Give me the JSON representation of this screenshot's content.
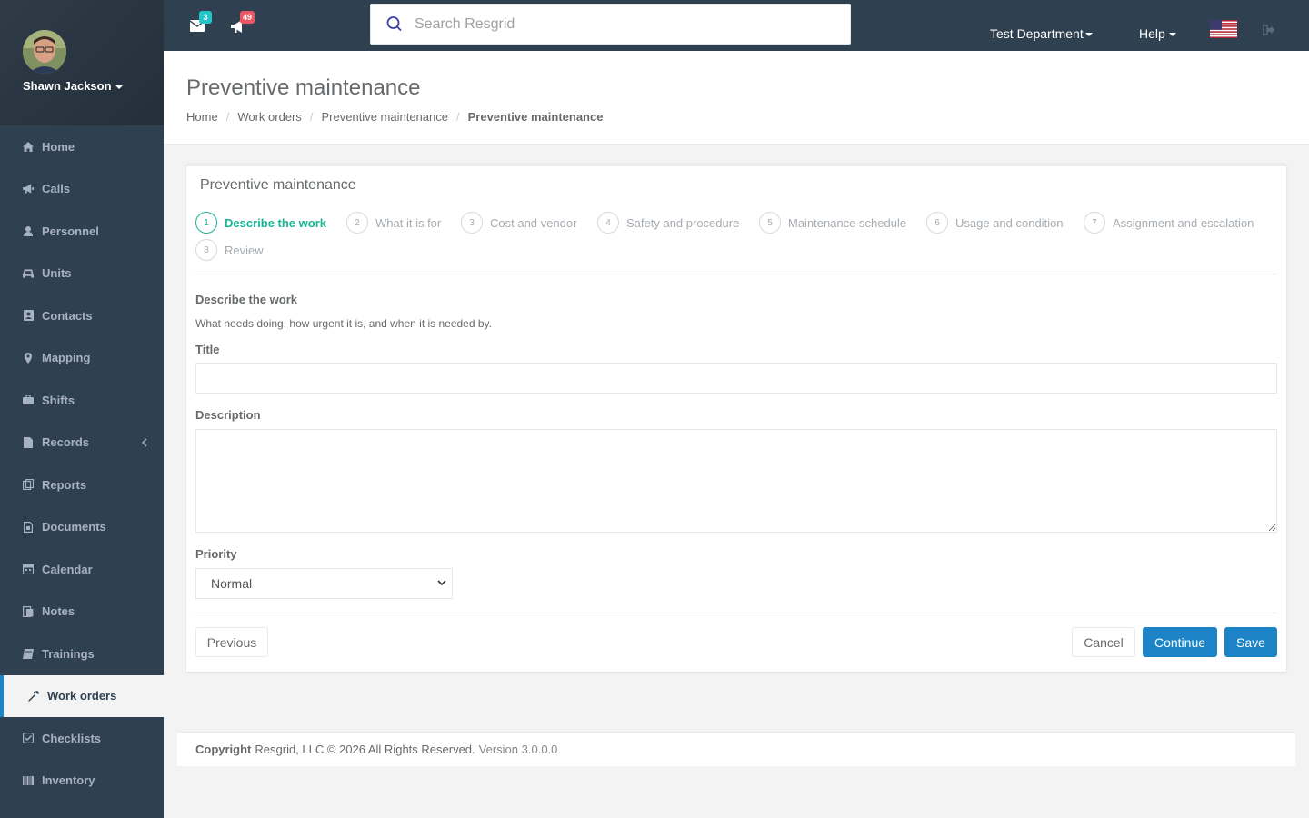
{
  "user": {
    "name": "Shawn Jackson"
  },
  "nav": [
    {
      "label": "Home",
      "icon": "home-icon"
    },
    {
      "label": "Calls",
      "icon": "bullhorn-icon"
    },
    {
      "label": "Personnel",
      "icon": "user-icon"
    },
    {
      "label": "Units",
      "icon": "truck-icon"
    },
    {
      "label": "Contacts",
      "icon": "address-book-icon"
    },
    {
      "label": "Mapping",
      "icon": "map-marker-icon"
    },
    {
      "label": "Shifts",
      "icon": "briefcase-icon"
    },
    {
      "label": "Records",
      "icon": "file-icon"
    },
    {
      "label": "Reports",
      "icon": "copy-icon"
    },
    {
      "label": "Documents",
      "icon": "file-doc-icon"
    },
    {
      "label": "Calendar",
      "icon": "calendar-icon"
    },
    {
      "label": "Notes",
      "icon": "notes-icon"
    },
    {
      "label": "Trainings",
      "icon": "book-icon"
    },
    {
      "label": "Work orders",
      "icon": "wrench-icon"
    },
    {
      "label": "Checklists",
      "icon": "check-square-icon"
    },
    {
      "label": "Inventory",
      "icon": "barcode-icon"
    }
  ],
  "topbar": {
    "messages_count": "3",
    "calls_count": "49",
    "search_placeholder": "Search Resgrid",
    "department": "Test Department",
    "help": "Help"
  },
  "page": {
    "title": "Preventive maintenance",
    "breadcrumb": [
      "Home",
      "Work orders",
      "Preventive maintenance",
      "Preventive maintenance"
    ]
  },
  "card": {
    "title": "Preventive maintenance",
    "steps": [
      {
        "num": "1",
        "label": "Describe the work"
      },
      {
        "num": "2",
        "label": "What it is for"
      },
      {
        "num": "3",
        "label": "Cost and vendor"
      },
      {
        "num": "4",
        "label": "Safety and procedure"
      },
      {
        "num": "5",
        "label": "Maintenance schedule"
      },
      {
        "num": "6",
        "label": "Usage and condition"
      },
      {
        "num": "7",
        "label": "Assignment and escalation"
      },
      {
        "num": "8",
        "label": "Review"
      }
    ],
    "section_title": "Describe the work",
    "section_desc": "What needs doing, how urgent it is, and when it is needed by.",
    "fields": {
      "title_label": "Title",
      "title_value": "",
      "description_label": "Description",
      "description_value": "",
      "priority_label": "Priority",
      "priority_value": "Normal"
    },
    "buttons": {
      "previous": "Previous",
      "cancel": "Cancel",
      "continue": "Continue",
      "save": "Save"
    }
  },
  "footer": {
    "copyright_label": "Copyright",
    "copyright_text": "Resgrid, LLC © 2026 All Rights Reserved.",
    "version": "Version 3.0.0.0"
  },
  "colors": {
    "sidebar": "#2f4050",
    "accent_green": "#1ab394",
    "primary_blue": "#1c84c6",
    "badge_teal": "#23c6c8",
    "badge_red": "#ed5565"
  }
}
